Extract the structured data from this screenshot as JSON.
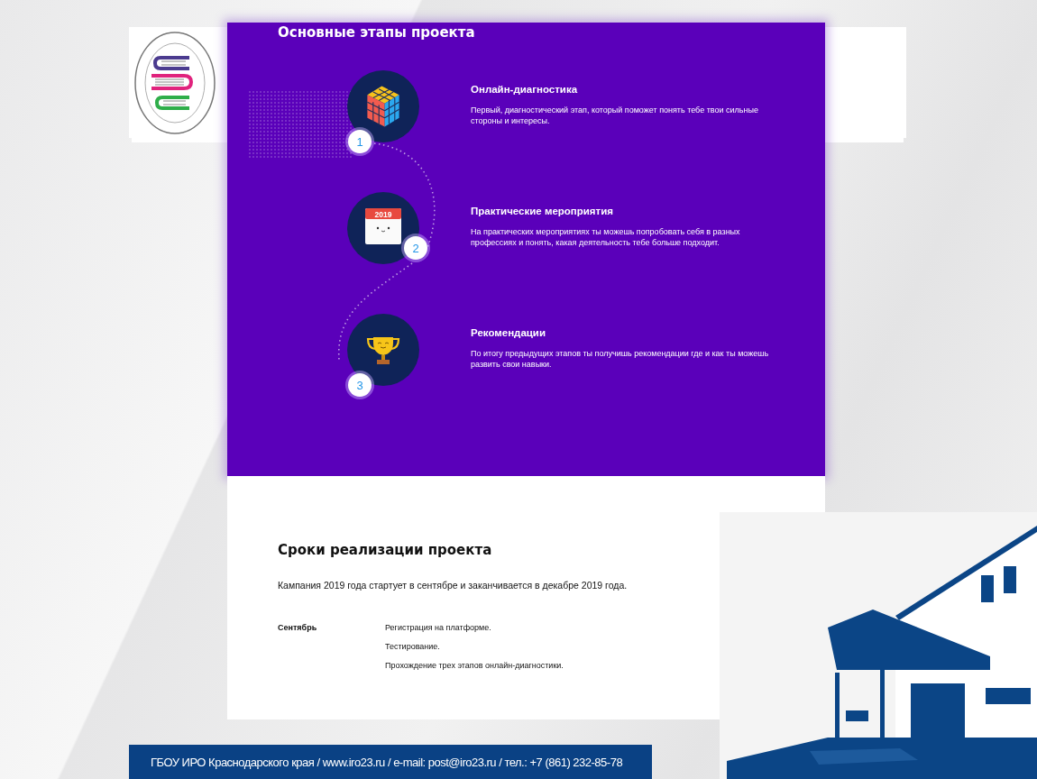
{
  "stages": {
    "title": "Основные этапы проекта",
    "items": [
      {
        "number": "1",
        "kind": "cube",
        "title": "Онлайн-диагностика",
        "text": "Первый, диагностический этап, который поможет понять тебе твои сильные стороны и интересы."
      },
      {
        "number": "2",
        "kind": "calendar",
        "icon_label": "2019",
        "title": "Практические мероприятия",
        "text": "На практических мероприятиях ты можешь попробовать себя в разных профессиях и понять, какая деятельность тебе больше подходит."
      },
      {
        "number": "3",
        "kind": "trophy",
        "title": "Рекомендации",
        "text": "По итогу предыдущих этапов ты получишь рекомендации где и как ты можешь развить свои навыки."
      }
    ]
  },
  "timeline": {
    "title": "Сроки реализации проекта",
    "intro": "Кампания 2019 года стартует в сентябре и заканчивается в декабре 2019 года.",
    "rows": [
      {
        "month": "Сентябрь",
        "tasks": [
          "Регистрация на платформе.",
          "Тестирование.",
          "Прохождение трех этапов онлайн-диагностики."
        ]
      }
    ]
  },
  "footer": {
    "text": "ГБОУ ИРО Краснодарского края / www.iro23.ru / e-mail: post@iro23.ru / тел.: +7 (861) 232-85-78"
  }
}
